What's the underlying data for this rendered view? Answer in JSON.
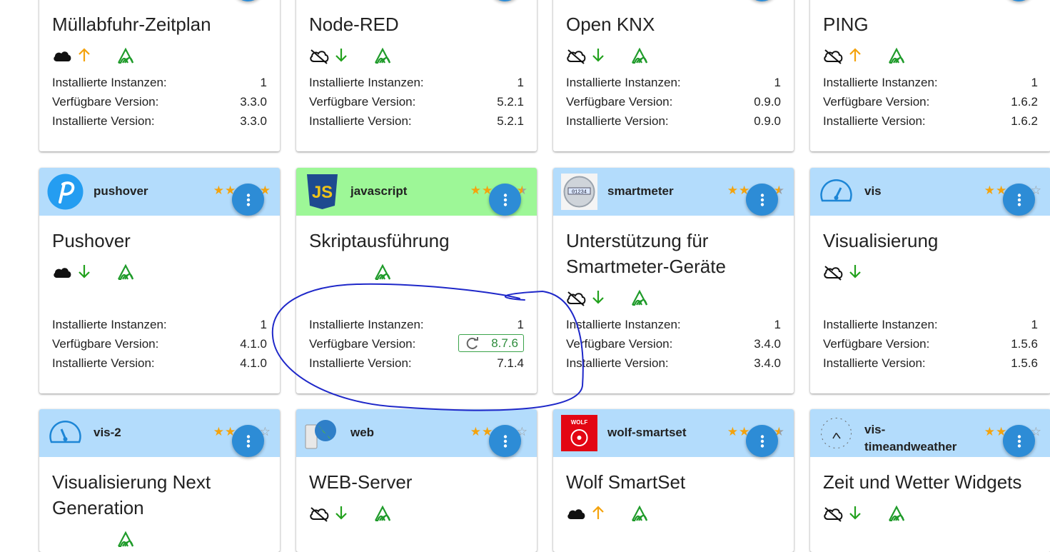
{
  "labels": {
    "instances": "Installierte Instanzen:",
    "available": "Verfügbare Version:",
    "installed": "Installierte Version:"
  },
  "colors": {
    "header_blue": "#b3dcfc",
    "header_green": "#9df797",
    "menu_button": "#2d8cd6",
    "star": "#f4a30d",
    "arrow_up": "#f4a30d",
    "arrow_down": "#22a11d",
    "connection_green": "#1f9b2a"
  },
  "cards": [
    {
      "title": "Müllabfuhr-Zeitplan",
      "cloud": "cloud-solid-icon",
      "arrow": "arrow-up-icon",
      "instances": "1",
      "available": "3.3.0",
      "installed": "3.3.0"
    },
    {
      "title": "Node-RED",
      "cloud": "cloud-off-icon",
      "arrow": "arrow-down-icon",
      "instances": "1",
      "available": "5.2.1",
      "installed": "5.2.1"
    },
    {
      "title": "Open KNX",
      "cloud": "cloud-off-icon",
      "arrow": "arrow-down-icon",
      "instances": "1",
      "available": "0.9.0",
      "installed": "0.9.0"
    },
    {
      "title": "PING",
      "cloud": "cloud-off-icon",
      "arrow": "arrow-up-icon",
      "instances": "1",
      "available": "1.6.2",
      "installed": "1.6.2"
    },
    {
      "name": "pushover",
      "title": "Pushover",
      "rating": 5,
      "cloud": "cloud-solid-icon",
      "arrow": "arrow-down-icon",
      "instances": "1",
      "available": "4.1.0",
      "installed": "4.1.0"
    },
    {
      "name": "javascript",
      "title": "Skriptausführung",
      "rating": 4.5,
      "instances": "1",
      "available": "8.7.6",
      "installed": "7.1.4",
      "update_available": true
    },
    {
      "name": "smartmeter",
      "title": "Unterstützung für Smartmeter-Geräte",
      "rating": 4.5,
      "cloud": "cloud-off-icon",
      "arrow": "arrow-down-icon",
      "instances": "1",
      "available": "3.4.0",
      "installed": "3.4.0"
    },
    {
      "name": "vis",
      "title": "Visualisierung",
      "rating": 4,
      "cloud": "cloud-off-icon",
      "arrow": "arrow-down-icon",
      "instances": "1",
      "available": "1.5.6",
      "installed": "1.5.6"
    },
    {
      "name": "vis-2",
      "title": "Visualisierung Next Generation",
      "rating": 4
    },
    {
      "name": "web",
      "title": "WEB-Server",
      "rating": 3.5,
      "cloud": "cloud-off-icon",
      "arrow": "arrow-down-icon"
    },
    {
      "name": "wolf-smartset",
      "title": "Wolf SmartSet",
      "rating": 4.5,
      "cloud": "cloud-solid-icon",
      "arrow": "arrow-up-icon",
      "logo_text": "WOLF"
    },
    {
      "name": "vis-timeandweather",
      "title": "Zeit und Wetter Widgets",
      "rating": 3.5,
      "cloud": "cloud-off-icon",
      "arrow": "arrow-down-icon"
    }
  ]
}
